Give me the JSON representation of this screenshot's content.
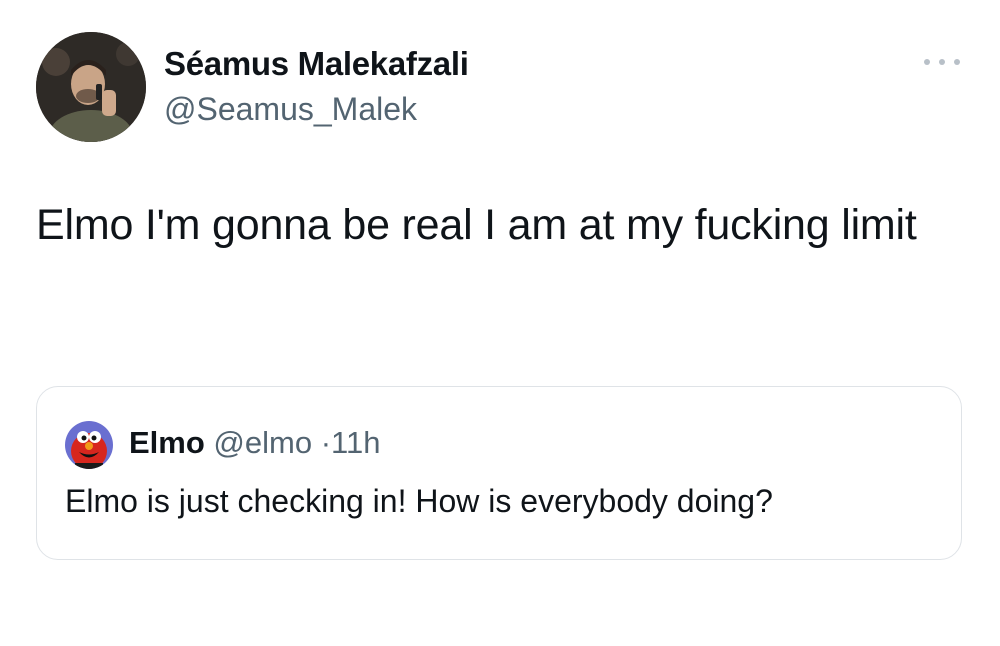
{
  "author": {
    "name": "Séamus Malekafzali",
    "handle": "@Seamus_Malek",
    "avatar_icon": "profile-photo"
  },
  "more_icon": "more-horizontal-icon",
  "tweet": {
    "text": "Elmo I'm gonna be real I am at my fucking limit"
  },
  "quoted_tweet": {
    "name": "Elmo",
    "handle": "@elmo",
    "separator": "·",
    "time": "11h",
    "text": "Elmo is just checking in! How is everybody doing?",
    "avatar_icon": "elmo-avatar"
  },
  "colors": {
    "text": "#0f1419",
    "secondary_text": "#536471",
    "border": "#dfe3e7",
    "elmo_red": "#d7261e"
  }
}
